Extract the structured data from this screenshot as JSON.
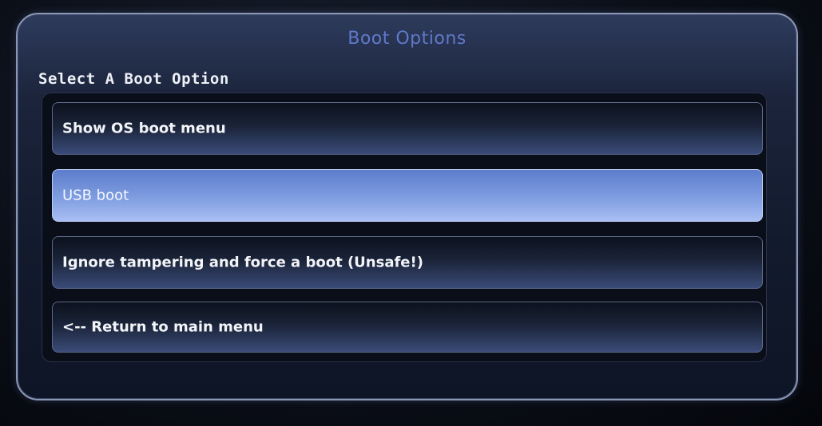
{
  "panel": {
    "title": "Boot Options",
    "section_label": "Select A Boot Option"
  },
  "options": [
    {
      "label": "Show OS boot menu",
      "selected": false
    },
    {
      "label": "USB boot",
      "selected": true
    },
    {
      "label": "Ignore tampering and force a boot (Unsafe!)",
      "selected": false
    },
    {
      "label": "<-- Return to main menu",
      "selected": false
    }
  ],
  "colors": {
    "title": "#5f79c9",
    "selected_highlight": "#7f9de0",
    "text": "#f2f4f8"
  }
}
